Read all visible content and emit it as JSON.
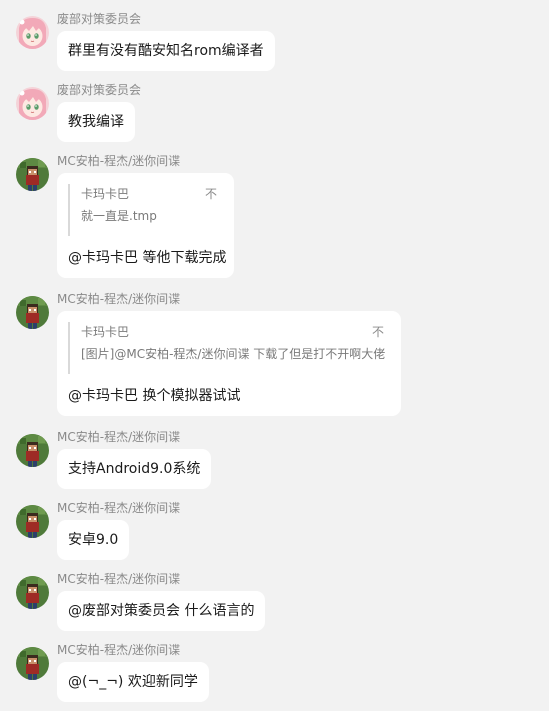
{
  "messages": [
    {
      "sender": "废部对策委员会",
      "avatar": "anime-girl-pink-hair-icon",
      "text": "群里有没有酷安知名rom编译者"
    },
    {
      "sender": "废部对策委员会",
      "avatar": "anime-girl-pink-hair-icon",
      "text": "教我编译"
    },
    {
      "sender": "MC安柏-程杰/迷你间谍",
      "avatar": "minecraft-character-icon",
      "quote": {
        "author": "卡玛卡巴",
        "mark": "不",
        "text": "就一直是.tmp"
      },
      "text": "@卡玛卡巴 等他下载完成"
    },
    {
      "sender": "MC安柏-程杰/迷你间谍",
      "avatar": "minecraft-character-icon",
      "quote": {
        "author": "卡玛卡巴",
        "mark": "不",
        "text": "[图片]@MC安柏-程杰/迷你间谍 下载了但是打不开啊大佬"
      },
      "text": "@卡玛卡巴 换个模拟器试试"
    },
    {
      "sender": "MC安柏-程杰/迷你间谍",
      "avatar": "minecraft-character-icon",
      "text": "支持Android9.0系统"
    },
    {
      "sender": "MC安柏-程杰/迷你间谍",
      "avatar": "minecraft-character-icon",
      "text": "安卓9.0"
    },
    {
      "sender": "MC安柏-程杰/迷你间谍",
      "avatar": "minecraft-character-icon",
      "text": "@废部对策委员会 什么语言的"
    },
    {
      "sender": "MC安柏-程杰/迷你间谍",
      "avatar": "minecraft-character-icon",
      "text": "@(¬_¬) 欢迎新同学"
    }
  ]
}
